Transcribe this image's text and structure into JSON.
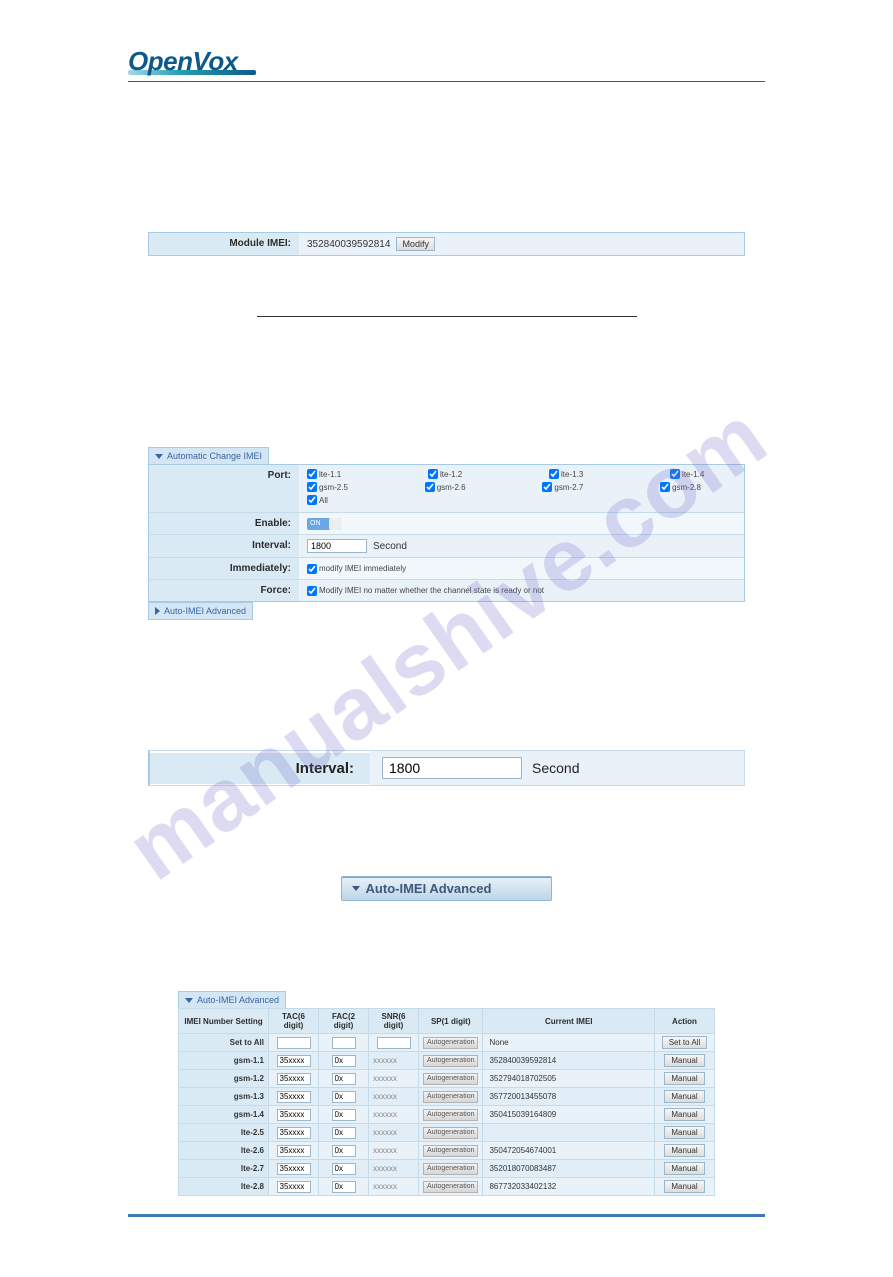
{
  "site": {
    "brand_a": "Open",
    "brand_b": "Vox",
    "watermark": "manualshive.com"
  },
  "imei_panel": {
    "label": "Module IMEI:",
    "value": "352840039592814",
    "modify_btn": "Modify"
  },
  "auto_change": {
    "section_title": "Automatic Change IMEI",
    "rows": {
      "port_label": "Port:",
      "enable_label": "Enable:",
      "interval_label": "Interval:",
      "immediately_label": "Immediately:",
      "force_label": "Force:"
    },
    "ports": [
      [
        "lte-1.1",
        "lte-1.2",
        "lte-1.3",
        "lte-1.4"
      ],
      [
        "gsm-2.5",
        "gsm-2.6",
        "gsm-2.7",
        "gsm-2.8"
      ]
    ],
    "port_all": "All",
    "enable_state": "ON",
    "interval_value": "1800",
    "interval_unit": "Second",
    "immediately_text": "modify IMEI immediately",
    "force_text": "Modify IMEI no matter whether the channel state is ready or not",
    "collapsed_title": "Auto-IMEI Advanced"
  },
  "big_interval": {
    "label": "Interval:",
    "value": "1800",
    "unit": "Second"
  },
  "adv_button": {
    "label": "Auto-IMEI Advanced"
  },
  "auto_imei_table": {
    "section_title": "Auto-IMEI Advanced",
    "headers": [
      "IMEI Number Setting",
      "TAC(6 digit)",
      "FAC(2 digit)",
      "SNR(6 digit)",
      "SP(1 digit)",
      "Current IMEI",
      "Action"
    ],
    "sp_label": "Autogeneration",
    "set_all_label": "Set to All",
    "none_label": "None",
    "set_all_btn": "Set to All",
    "manual_btn": "Manual",
    "rows": [
      {
        "name": "gsm-1.1",
        "tac": "35xxxx",
        "fac": "0x",
        "snr": "xxxxxx",
        "imei": "352840039592814"
      },
      {
        "name": "gsm-1.2",
        "tac": "35xxxx",
        "fac": "0x",
        "snr": "xxxxxx",
        "imei": "352794018702505"
      },
      {
        "name": "gsm-1.3",
        "tac": "35xxxx",
        "fac": "0x",
        "snr": "xxxxxx",
        "imei": "357720013455078"
      },
      {
        "name": "gsm-1.4",
        "tac": "35xxxx",
        "fac": "0x",
        "snr": "xxxxxx",
        "imei": "350415039164809"
      },
      {
        "name": "lte-2.5",
        "tac": "35xxxx",
        "fac": "0x",
        "snr": "xxxxxx",
        "imei": ""
      },
      {
        "name": "lte-2.6",
        "tac": "35xxxx",
        "fac": "0x",
        "snr": "xxxxxx",
        "imei": "350472054674001"
      },
      {
        "name": "lte-2.7",
        "tac": "35xxxx",
        "fac": "0x",
        "snr": "xxxxxx",
        "imei": "352018070083487"
      },
      {
        "name": "lte-2.8",
        "tac": "35xxxx",
        "fac": "0x",
        "snr": "xxxxxx",
        "imei": "867732033402132"
      }
    ]
  }
}
